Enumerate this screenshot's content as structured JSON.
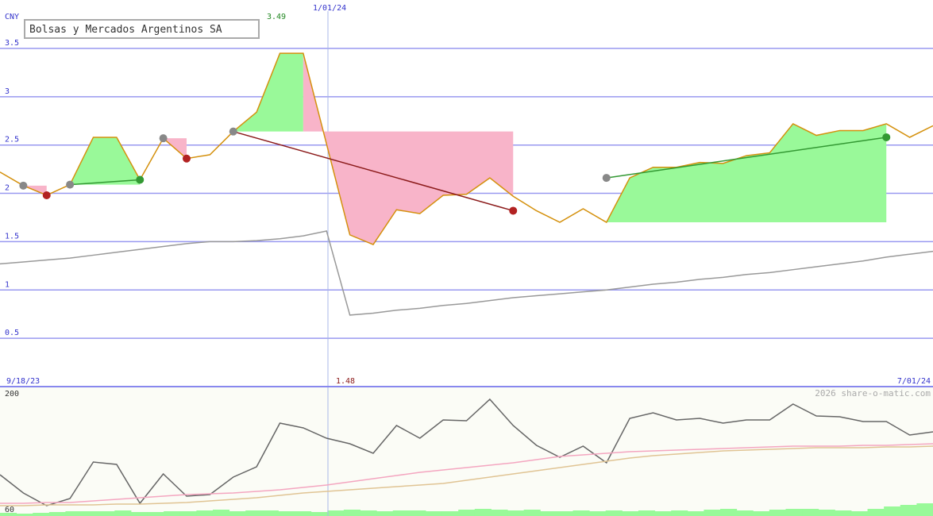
{
  "chart_data": [
    {
      "type": "line",
      "title": "Bolsas y Mercados Argentinos SA",
      "currency": "CNY",
      "ylim": [
        0,
        3.6
      ],
      "yticks": [
        "3.5",
        "3",
        "2.5",
        "2",
        "1.5",
        "1",
        "0.5"
      ],
      "x_start_label": "9/18/23",
      "x_marker_label": "1/01/24",
      "x_end_label": "7/01/24",
      "max_label": "3.49",
      "min_label": "1.48",
      "colors": {
        "price": "#d4900c",
        "ma": "#999999",
        "up": "#99f999",
        "down": "#f8b4c9",
        "grid": "#9999f0",
        "buy": "#339933",
        "sell": "#b22222",
        "neutral": "#888888"
      },
      "price_series": {
        "name": "",
        "x": [
          0,
          1,
          2,
          3,
          4,
          5,
          6,
          7,
          8,
          9,
          10,
          11,
          12,
          13,
          14,
          15,
          16,
          17,
          18,
          19,
          20,
          21,
          22,
          23,
          24,
          25,
          26,
          27,
          28,
          29,
          30,
          31,
          32,
          33,
          34,
          35,
          36,
          37,
          38,
          39,
          40
        ],
        "y": [
          2.22,
          2.08,
          1.98,
          2.09,
          2.58,
          2.58,
          2.14,
          2.57,
          2.36,
          2.4,
          2.64,
          2.84,
          3.45,
          3.45,
          2.51,
          1.57,
          1.47,
          1.83,
          1.79,
          1.98,
          1.99,
          2.16,
          1.97,
          1.82,
          1.7,
          1.84,
          1.7,
          2.16,
          2.27,
          2.27,
          2.32,
          2.31,
          2.39,
          2.42,
          2.72,
          2.6,
          2.65,
          2.65,
          2.72,
          2.58,
          2.7
        ]
      },
      "moving_average": {
        "name": "",
        "y": [
          1.27,
          1.29,
          1.31,
          1.33,
          1.36,
          1.39,
          1.42,
          1.45,
          1.48,
          1.5,
          1.5,
          1.51,
          1.53,
          1.56,
          1.61,
          0.74,
          0.76,
          0.79,
          0.81,
          0.84,
          0.86,
          0.89,
          0.92,
          0.94,
          0.96,
          0.98,
          1.0,
          1.03,
          1.06,
          1.08,
          1.11,
          1.13,
          1.16,
          1.18,
          1.21,
          1.24,
          1.27,
          1.3,
          1.34,
          1.37,
          1.4
        ]
      },
      "signals": [
        {
          "type": "neutral",
          "i": 1,
          "y": 2.08
        },
        {
          "type": "sell",
          "i": 2,
          "y": 1.98
        },
        {
          "type": "neutral",
          "i": 3,
          "y": 2.09
        },
        {
          "type": "buy",
          "i": 6,
          "y": 2.14
        },
        {
          "type": "neutral",
          "i": 7,
          "y": 2.57
        },
        {
          "type": "sell",
          "i": 8,
          "y": 2.36
        },
        {
          "type": "neutral",
          "i": 10,
          "y": 2.64
        },
        {
          "type": "sell",
          "i": 22,
          "y": 1.82
        },
        {
          "type": "neutral",
          "i": 26,
          "y": 2.16
        },
        {
          "type": "buy",
          "i": 38,
          "y": 2.58
        }
      ],
      "trend_lines": [
        {
          "type": "buy",
          "from": [
            3,
            2.09
          ],
          "to": [
            6,
            2.14
          ]
        },
        {
          "type": "sell",
          "from": [
            10,
            2.64
          ],
          "to": [
            22,
            1.82
          ]
        },
        {
          "type": "buy",
          "from": [
            26,
            2.16
          ],
          "to": [
            38,
            2.58
          ]
        }
      ]
    },
    {
      "type": "line",
      "ylim": [
        60,
        200
      ],
      "yticks": [
        "200",
        "60"
      ],
      "watermark": "2026 share-o-matic.com",
      "series": [
        {
          "name": "",
          "color": "#666666",
          "values": [
            99,
            76,
            60,
            69,
            115,
            112,
            63,
            100,
            72,
            74,
            96,
            109,
            164,
            158,
            145,
            138,
            126,
            161,
            145,
            168,
            167,
            194,
            161,
            136,
            121,
            135,
            114,
            170,
            177,
            168,
            170,
            164,
            168,
            168,
            188,
            173,
            172,
            166,
            166,
            149,
            153
          ]
        },
        {
          "name": "",
          "color": "#f4a6c0",
          "values": [
            63,
            63,
            64,
            64,
            66,
            68,
            70,
            72,
            74,
            75,
            76,
            78,
            80,
            83,
            86,
            90,
            94,
            98,
            102,
            105,
            108,
            111,
            114,
            118,
            122,
            124,
            126,
            128,
            129,
            130,
            131,
            132,
            133,
            134,
            135,
            135,
            135,
            136,
            136,
            137,
            138
          ]
        },
        {
          "name": "",
          "color": "#e0c494",
          "values": [
            60,
            60,
            61,
            61,
            61,
            62,
            62,
            63,
            64,
            66,
            68,
            70,
            73,
            76,
            78,
            80,
            82,
            84,
            86,
            88,
            92,
            96,
            100,
            104,
            108,
            112,
            116,
            120,
            123,
            125,
            127,
            129,
            130,
            131,
            132,
            133,
            133,
            133,
            134,
            134,
            135
          ]
        }
      ],
      "volume": [
        4,
        3,
        4,
        5,
        6,
        6,
        6,
        7,
        5,
        5,
        6,
        6,
        7,
        8,
        6,
        7,
        7,
        6,
        6,
        5,
        7,
        8,
        7,
        6,
        7,
        7,
        6,
        6,
        8,
        9,
        8,
        7,
        8,
        6,
        6,
        7,
        6,
        7,
        6,
        7,
        6,
        7,
        6,
        8,
        9,
        7,
        6,
        8,
        9,
        9,
        8,
        7,
        6,
        9,
        12,
        14,
        16
      ]
    }
  ]
}
